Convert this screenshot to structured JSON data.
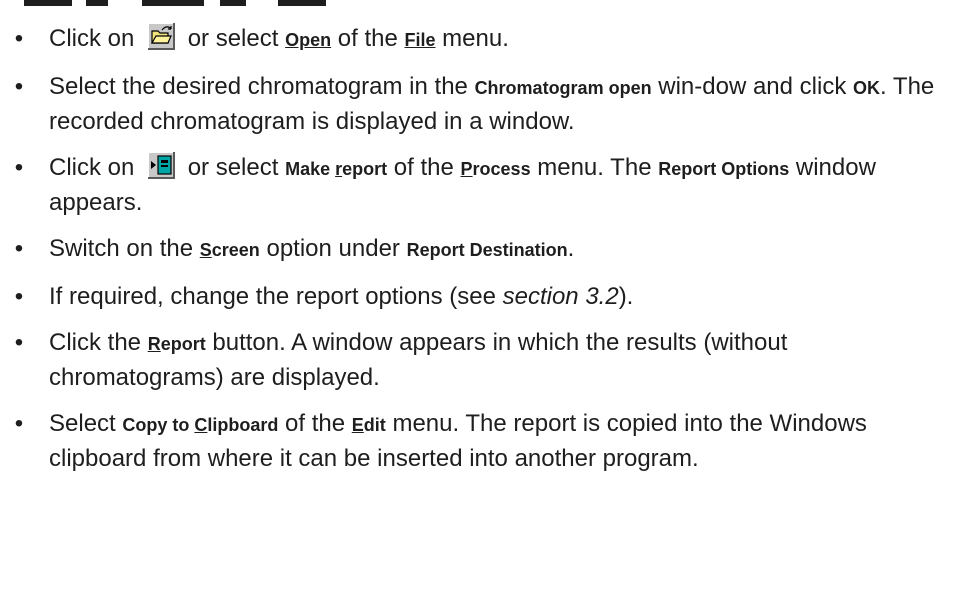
{
  "steps": {
    "s1": {
      "t1": "Click on",
      "t2": " or select ",
      "open": "Open",
      "open_rest": "pen",
      "t3": " of the ",
      "file": "F",
      "file_rest": "ile",
      "t4": " menu."
    },
    "s2": {
      "t1": "Select the desired chromatogram in the ",
      "window_name": "Chromatogram open",
      "t2": " win-dow and click ",
      "ok": "OK",
      "t3": ". The recorded chromatogram is displayed in a window."
    },
    "s3": {
      "t1": "Click on",
      "t2": " or select ",
      "make": "Make ",
      "report_r": "r",
      "report_rest": "eport",
      "t3": " of the ",
      "process_p": "P",
      "process_rest": "rocess",
      "t4": " menu. The ",
      "report_options": "Report Options",
      "t5": " window appears."
    },
    "s4": {
      "t1": "Switch on the ",
      "screen_s": "S",
      "screen_rest": "creen",
      "t2": " option under ",
      "report_destination": "Report Destination",
      "t3": "."
    },
    "s5": {
      "t1": "If required, change the report options (see ",
      "section": "section 3.2",
      "t2": ")."
    },
    "s6": {
      "t1": "Click the ",
      "report_r": "R",
      "report_rest": "eport",
      "t2": " button. A window appears in which the results (without chromatograms) are displayed."
    },
    "s7": {
      "t1": "Select ",
      "copy": "Copy to ",
      "clip_c": "C",
      "clip_rest": "lipboard",
      "t2": " of the ",
      "edit_e": "E",
      "edit_rest": "dit",
      "t3": " menu. The report is copied into the Windows clipboard from where it can be inserted into another program."
    }
  },
  "icons": {
    "open_folder": "open-folder-icon",
    "make_report": "make-report-icon"
  },
  "bullet": "•"
}
